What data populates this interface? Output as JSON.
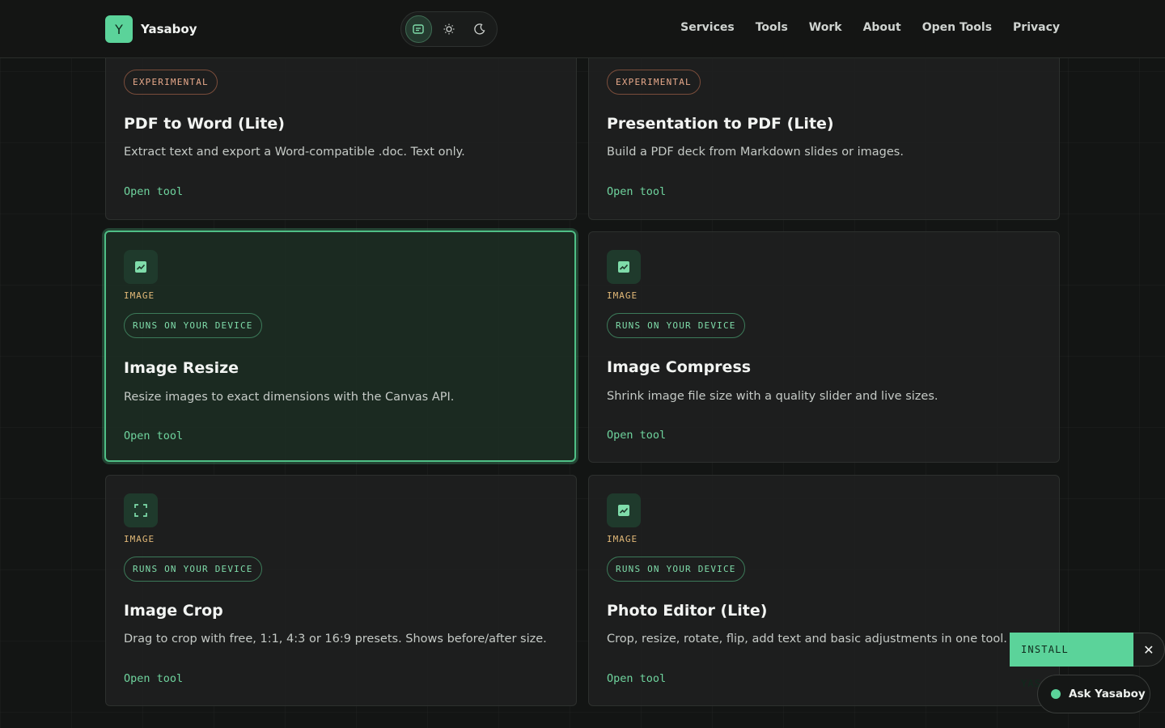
{
  "brand": {
    "logo_letter": "Y",
    "name": "Yasaboy"
  },
  "theme": {
    "options": [
      "system-icon",
      "sun-icon",
      "moon-icon"
    ],
    "active": "system"
  },
  "nav": [
    "Services",
    "Tools",
    "Work",
    "About",
    "Open Tools",
    "Privacy"
  ],
  "cards": [
    {
      "badge": "EXPERIMENTAL",
      "title": "PDF to Word (Lite)",
      "desc": "Extract text and export a Word-compatible .doc. Text only.",
      "cta": "Open tool"
    },
    {
      "badge": "EXPERIMENTAL",
      "title": "Presentation to PDF (Lite)",
      "desc": "Build a PDF deck from Markdown slides or images.",
      "cta": "Open tool"
    },
    {
      "category": "IMAGE",
      "badge": "RUNS ON YOUR DEVICE",
      "title": "Image Resize",
      "desc": "Resize images to exact dimensions with the Canvas API.",
      "cta": "Open tool",
      "icon": "image-icon"
    },
    {
      "category": "IMAGE",
      "badge": "RUNS ON YOUR DEVICE",
      "title": "Image Compress",
      "desc": "Shrink image file size with a quality slider and live sizes.",
      "cta": "Open tool",
      "icon": "image-icon"
    },
    {
      "category": "IMAGE",
      "badge": "RUNS ON YOUR DEVICE",
      "title": "Image Crop",
      "desc": "Drag to crop with free, 1:1, 4:3 or 16:9 presets. Shows before/after size.",
      "cta": "Open tool",
      "icon": "crop-icon"
    },
    {
      "category": "IMAGE",
      "badge": "RUNS ON YOUR DEVICE",
      "title": "Photo Editor (Lite)",
      "desc": "Crop, resize, rotate, flip, add text and basic adjustments in one tool.",
      "cta": "Open tool",
      "icon": "image-icon"
    }
  ],
  "install": {
    "label": "INSTALL YASABOY",
    "close": "✕"
  },
  "assistant": {
    "label": "Ask Yasaboy"
  },
  "colors": {
    "accent": "#5bd39a",
    "category": "#e2b978",
    "experimental": "#e7a98b"
  }
}
